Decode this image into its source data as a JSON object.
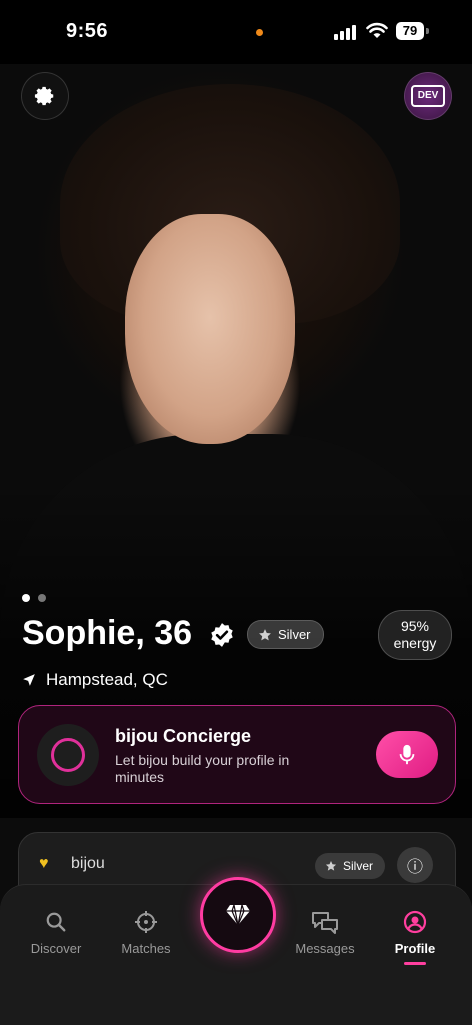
{
  "status_bar": {
    "time": "9:56",
    "battery": "79"
  },
  "top_buttons": {
    "dev_label": "DEV"
  },
  "profile": {
    "name": "Sophie, 36",
    "tier": "Silver",
    "energy_value": "95%",
    "energy_label": "energy",
    "location": "Hampstead, QC",
    "photo_count": 2,
    "active_photo": 1
  },
  "concierge": {
    "title": "bijou Concierge",
    "subtitle": "Let bijou build your profile in minutes"
  },
  "secondary_card": {
    "label": "bijou",
    "tier": "Silver"
  },
  "tabs": [
    {
      "label": "Discover",
      "icon": "search-icon"
    },
    {
      "label": "Matches",
      "icon": "crosshair-icon"
    },
    {
      "label": "Messages",
      "icon": "chat-bubbles-icon"
    },
    {
      "label": "Profile",
      "icon": "user-icon",
      "active": true
    }
  ],
  "colors": {
    "accent": "#ff3f9f",
    "card_border": "#b0247d"
  }
}
